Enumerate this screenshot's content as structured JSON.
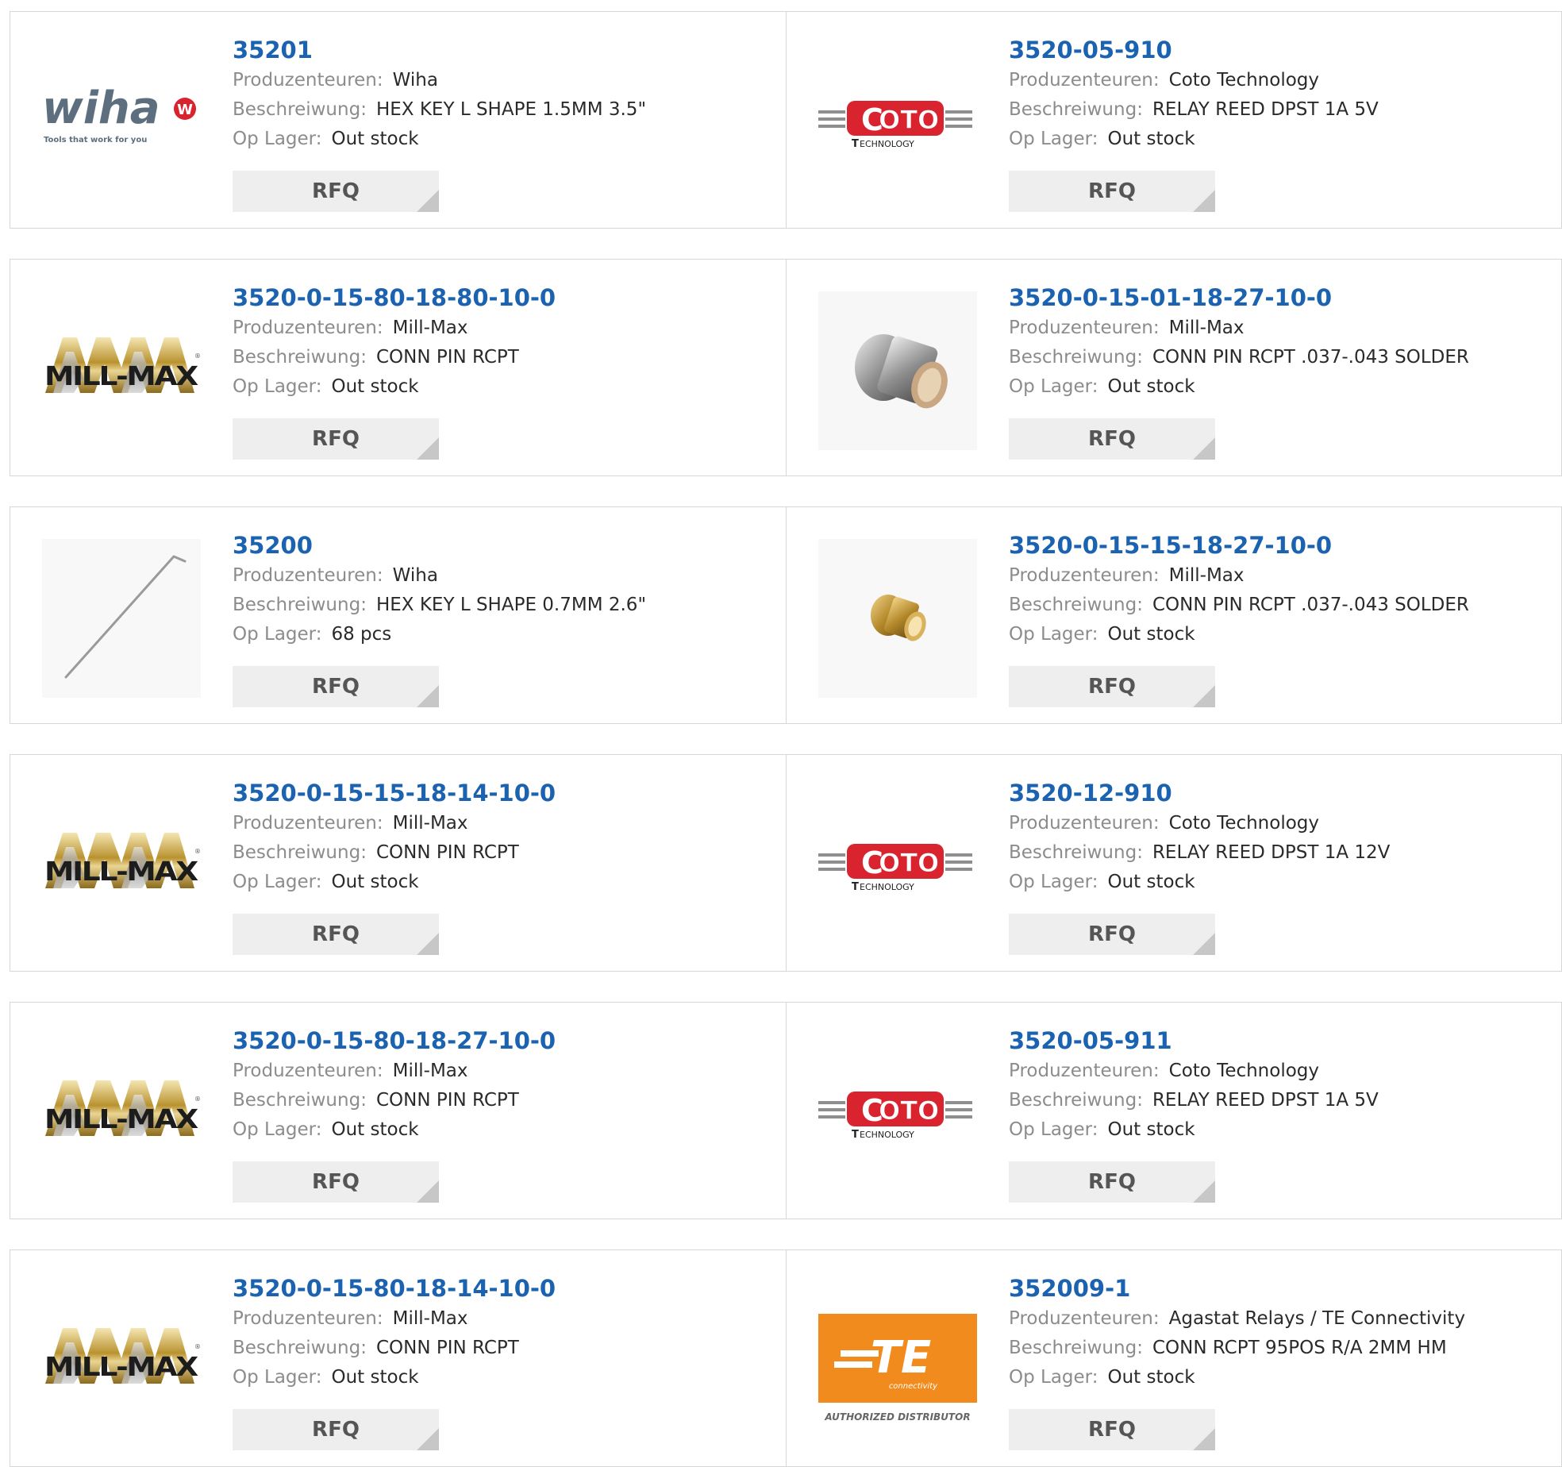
{
  "labels": {
    "manufacturer": "Produzenteuren:",
    "description": "Beschreiwung:",
    "stock": "Op Lager:",
    "rfq": "RFQ"
  },
  "logos": {
    "wiha_text": "wiha",
    "wiha_tagline": "Tools that work for you",
    "millmax_text": "MILL-MAX",
    "coto_text": "OTO",
    "coto_sub": "ECHNOLOGY",
    "te_text": "TE",
    "te_sub": "connectivity",
    "te_badge": "AUTHORIZED DISTRIBUTOR"
  },
  "colors": {
    "link": "#1b63b0",
    "coto_red": "#d9232e",
    "te_orange": "#f28b1d"
  },
  "products": [
    {
      "part": "35201",
      "manufacturer": "Wiha",
      "description": "HEX KEY L SHAPE 1.5MM 3.5\"",
      "stock": "Out stock",
      "image": "wiha-logo"
    },
    {
      "part": "3520-05-910",
      "manufacturer": "Coto Technology",
      "description": "RELAY REED DPST 1A 5V",
      "stock": "Out stock",
      "image": "coto-logo"
    },
    {
      "part": "3520-0-15-80-18-80-10-0",
      "manufacturer": "Mill-Max",
      "description": "CONN PIN RCPT",
      "stock": "Out stock",
      "image": "millmax-logo"
    },
    {
      "part": "3520-0-15-01-18-27-10-0",
      "manufacturer": "Mill-Max",
      "description": "CONN PIN RCPT .037-.043 SOLDER",
      "stock": "Out stock",
      "image": "silver-pin-photo"
    },
    {
      "part": "35200",
      "manufacturer": "Wiha",
      "description": "HEX KEY L SHAPE 0.7MM 2.6\"",
      "stock": "68 pcs",
      "image": "hex-key-photo"
    },
    {
      "part": "3520-0-15-15-18-27-10-0",
      "manufacturer": "Mill-Max",
      "description": "CONN PIN RCPT .037-.043 SOLDER",
      "stock": "Out stock",
      "image": "gold-pin-photo"
    },
    {
      "part": "3520-0-15-15-18-14-10-0",
      "manufacturer": "Mill-Max",
      "description": "CONN PIN RCPT",
      "stock": "Out stock",
      "image": "millmax-logo"
    },
    {
      "part": "3520-12-910",
      "manufacturer": "Coto Technology",
      "description": "RELAY REED DPST 1A 12V",
      "stock": "Out stock",
      "image": "coto-logo"
    },
    {
      "part": "3520-0-15-80-18-27-10-0",
      "manufacturer": "Mill-Max",
      "description": "CONN PIN RCPT",
      "stock": "Out stock",
      "image": "millmax-logo"
    },
    {
      "part": "3520-05-911",
      "manufacturer": "Coto Technology",
      "description": "RELAY REED DPST 1A 5V",
      "stock": "Out stock",
      "image": "coto-logo"
    },
    {
      "part": "3520-0-15-80-18-14-10-0",
      "manufacturer": "Mill-Max",
      "description": "CONN PIN RCPT",
      "stock": "Out stock",
      "image": "millmax-logo"
    },
    {
      "part": "352009-1",
      "manufacturer": "Agastat Relays / TE Connectivity",
      "description": "CONN RCPT 95POS R/A 2MM HM",
      "stock": "Out stock",
      "image": "te-logo"
    }
  ]
}
